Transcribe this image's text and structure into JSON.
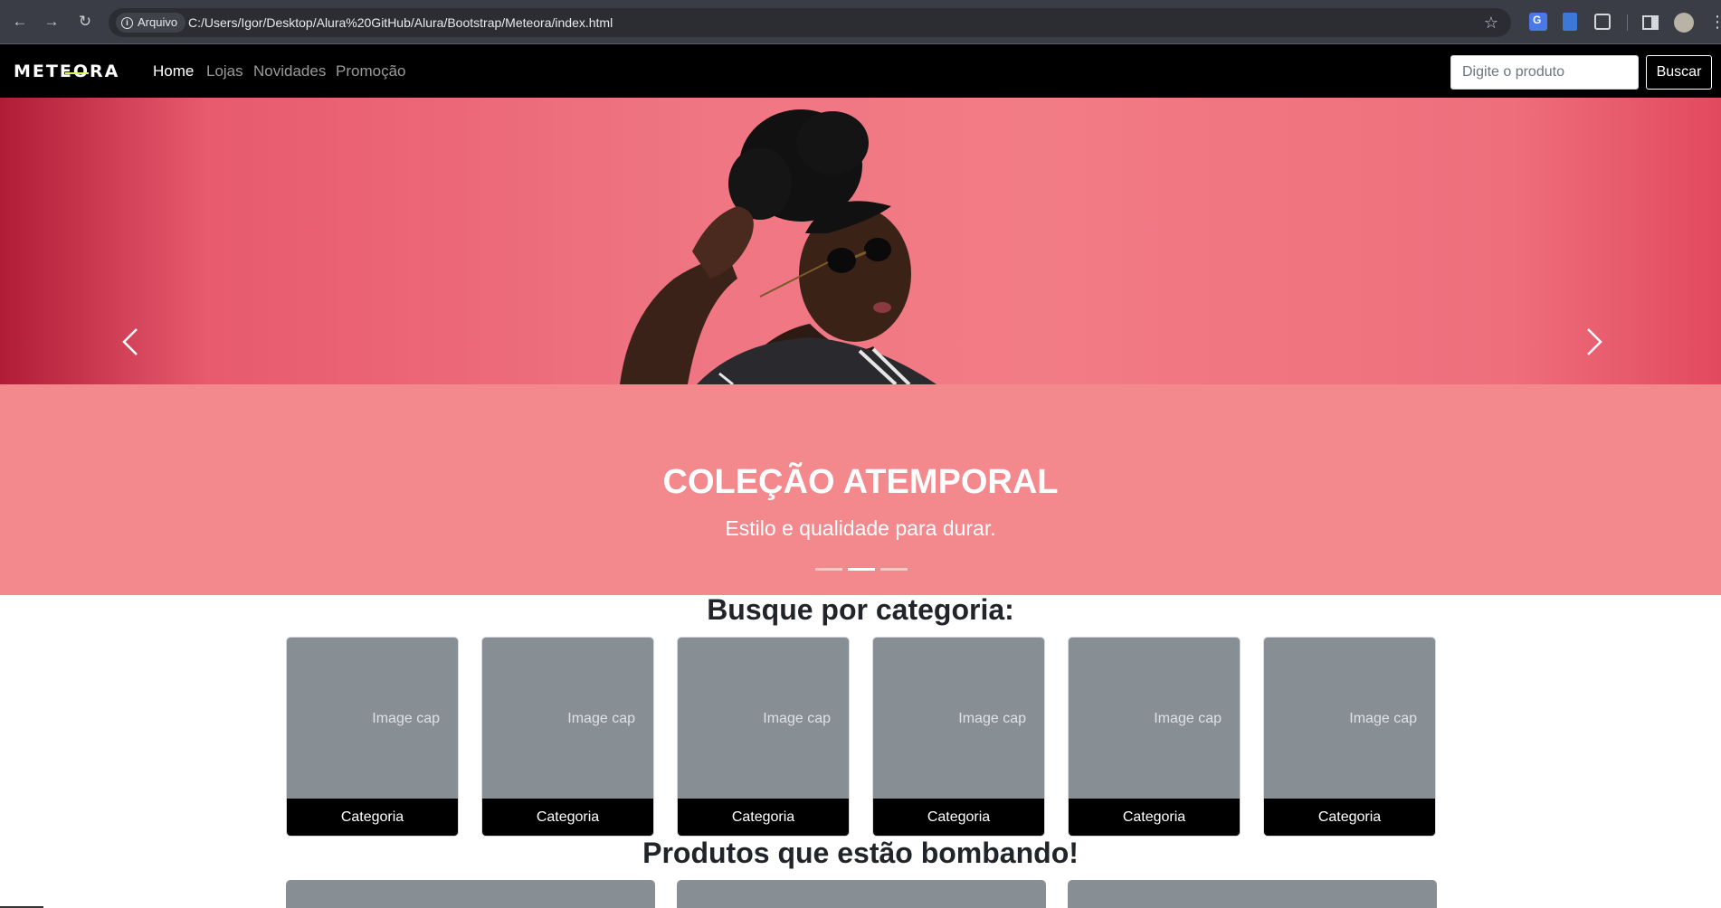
{
  "browser": {
    "security_label": "Arquivo",
    "url": "C:/Users/Igor/Desktop/Alura%20GitHub/Alura/Bootstrap/Meteora/index.html"
  },
  "navbar": {
    "brand": "METEORA",
    "links": [
      {
        "label": "Home",
        "active": true
      },
      {
        "label": "Lojas",
        "active": false
      },
      {
        "label": "Novidades",
        "active": false
      },
      {
        "label": "Promoção",
        "active": false
      }
    ],
    "search_placeholder": "Digite o produto",
    "search_button": "Buscar"
  },
  "carousel": {
    "title": "COLEÇÃO ATEMPORAL",
    "subtitle": "Estilo e qualidade para durar.",
    "indicators": 3,
    "active_indicator": 1
  },
  "categories": {
    "title": "Busque por categoria:",
    "cards": [
      {
        "image_text": "Image cap",
        "label": "Categoria"
      },
      {
        "image_text": "Image cap",
        "label": "Categoria"
      },
      {
        "image_text": "Image cap",
        "label": "Categoria"
      },
      {
        "image_text": "Image cap",
        "label": "Categoria"
      },
      {
        "image_text": "Image cap",
        "label": "Categoria"
      },
      {
        "image_text": "Image cap",
        "label": "Categoria"
      }
    ]
  },
  "products": {
    "title": "Produtos que estão bombando!"
  },
  "colors": {
    "navbar_bg": "#000000",
    "caption_band": "#f3888d",
    "card_placeholder": "#878e94"
  }
}
